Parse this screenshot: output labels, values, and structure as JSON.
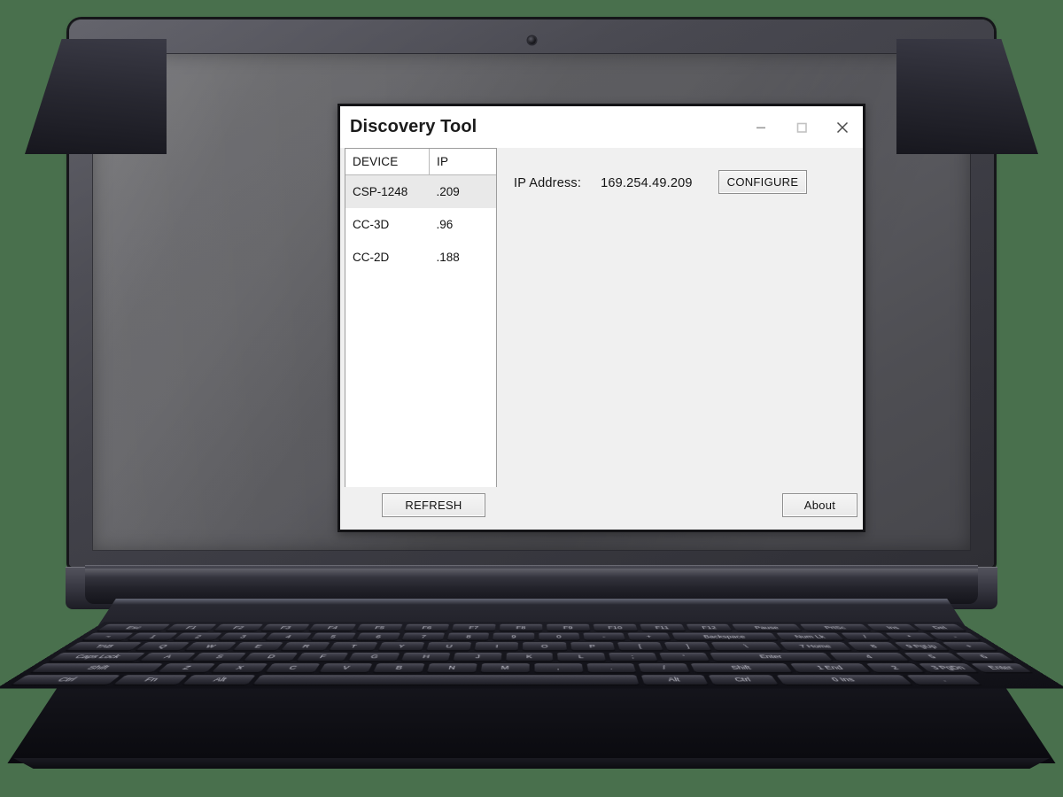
{
  "scene": {
    "backdrop_color": "#49704d",
    "device_type": "laptop",
    "bezel_color": "#45454d",
    "desktop_background_color": "#5d5d62"
  },
  "app_window": {
    "title": "Discovery Tool",
    "title_bar_background": "#ffffff",
    "window_background": "#f0f0f0",
    "controls": [
      {
        "name": "minimize",
        "glyph": "—",
        "color": "#9a9a9a"
      },
      {
        "name": "maximize",
        "glyph": "□",
        "color": "#c2c2c2"
      },
      {
        "name": "close",
        "glyph": "✕",
        "color": "#4a4a4a"
      }
    ],
    "device_list": {
      "columns": [
        "DEVICE",
        "IP"
      ],
      "rows": [
        {
          "device": "CSP-1248",
          "ip": ".209",
          "selected": true
        },
        {
          "device": "CC-3D",
          "ip": ".96",
          "selected": false
        },
        {
          "device": "CC-2D",
          "ip": ".188",
          "selected": false
        }
      ],
      "selected_row_background": "#e9e9e9",
      "panel_background": "#ffffff"
    },
    "detail": {
      "ip_label": "IP Address:",
      "ip_value": "169.254.49.209",
      "configure_label": "CONFIGURE"
    },
    "footer": {
      "refresh_label": "REFRESH",
      "about_label": "About"
    }
  },
  "keyboard": {
    "rows": [
      [
        "Esc",
        "F1",
        "F2",
        "F3",
        "F4",
        "F5",
        "F6",
        "F7",
        "F8",
        "F9",
        "F10",
        "F11",
        "F12",
        "Pause",
        "PrtSc",
        "Ins",
        "Del"
      ],
      [
        "~",
        "1",
        "2",
        "3",
        "4",
        "5",
        "6",
        "7",
        "8",
        "9",
        "0",
        "-",
        "+",
        "Backspace",
        "Num Lk",
        "/",
        "*",
        "-"
      ],
      [
        "TAB",
        "Q",
        "W",
        "E",
        "R",
        "T",
        "Y",
        "U",
        "I",
        "O",
        "P",
        "[",
        "]",
        "\\",
        "7 Home",
        "8",
        "9 PgUp",
        "+"
      ],
      [
        "Caps Lock",
        "A",
        "S",
        "D",
        "F",
        "G",
        "H",
        "J",
        "K",
        "L",
        ";",
        "'",
        "Enter",
        "4",
        "5",
        "6"
      ],
      [
        "Shift",
        "Z",
        "X",
        "C",
        "V",
        "B",
        "N",
        "M",
        ",",
        ".",
        "/",
        "Shift",
        "1 End",
        "2",
        "3 PgDn",
        "Enter"
      ],
      [
        "Ctrl",
        "Fn",
        "Alt",
        "",
        "Alt",
        "Ctrl",
        "0 Ins",
        ".",
        ""
      ]
    ]
  }
}
